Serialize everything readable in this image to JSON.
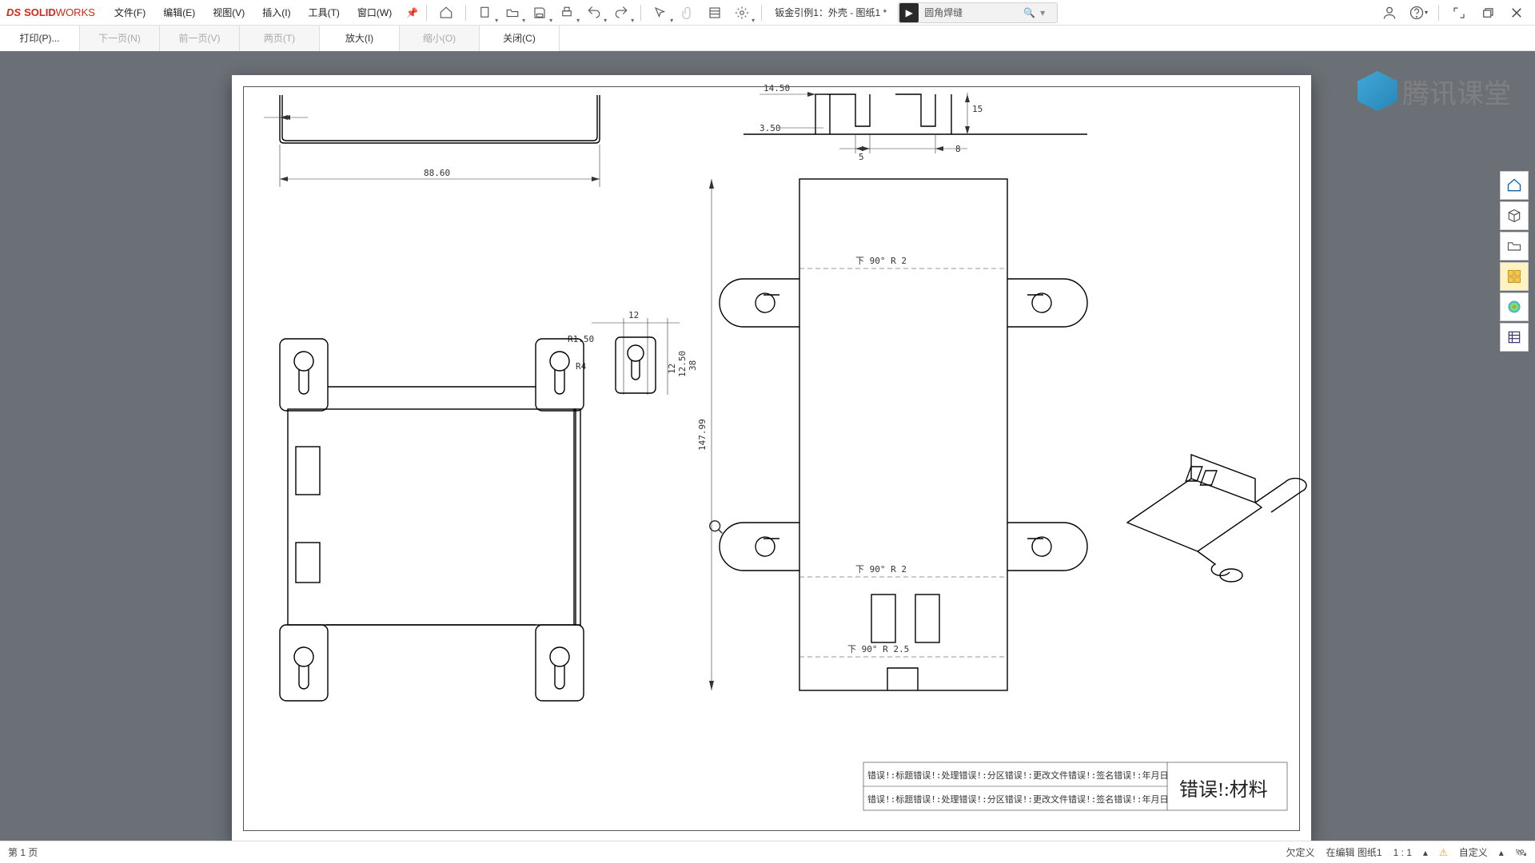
{
  "app": {
    "logo_ds": "DS",
    "logo_solid": "SOLID",
    "logo_works": "WORKS"
  },
  "menu": {
    "file": "文件(F)",
    "edit": "编辑(E)",
    "view": "视图(V)",
    "insert": "插入(I)",
    "tools": "工具(T)",
    "window": "窗口(W)"
  },
  "doc_title": "钣金引例1：外壳 - 图纸1 *",
  "search": {
    "text": "圆角焊缝"
  },
  "pp": {
    "print": "打印(P)...",
    "next": "下一页(N)",
    "prev": "前一页(V)",
    "two": "两页(T)",
    "zin": "放大(I)",
    "zout": "缩小(O)",
    "close": "关闭(C)"
  },
  "dims": {
    "d88_60": "88.60",
    "d14_50": "14.50",
    "d15": "15",
    "d3_50": "3.50",
    "d5": "5",
    "d8": "8",
    "d147_99": "147.99",
    "d12": "12",
    "r1_50": "R1.50",
    "r4": "R4",
    "d12_50": "12.50",
    "d38": "38",
    "bend1": "下  90°   R 2",
    "bend2": "下  90°   R 2",
    "bend3": "下  90°   R 2.5"
  },
  "titleblock": {
    "l1": "错误!:标题错误!:处理错误!:分区错误!:更改文件错误!:签名错误!:年月日",
    "l2": "错误!:标题错误!:处理错误!:分区错误!:更改文件错误!:签名错误!:年月日",
    "mat": "错误!:材料"
  },
  "watermark": "腾讯课堂",
  "side": [
    "home",
    "cube",
    "folder",
    "tile",
    "color",
    "list"
  ],
  "status": {
    "page": "第 1 页",
    "undef": "欠定义",
    "editing": "在编辑  图纸1",
    "scale": "1 : 1",
    "custom": "自定义"
  }
}
